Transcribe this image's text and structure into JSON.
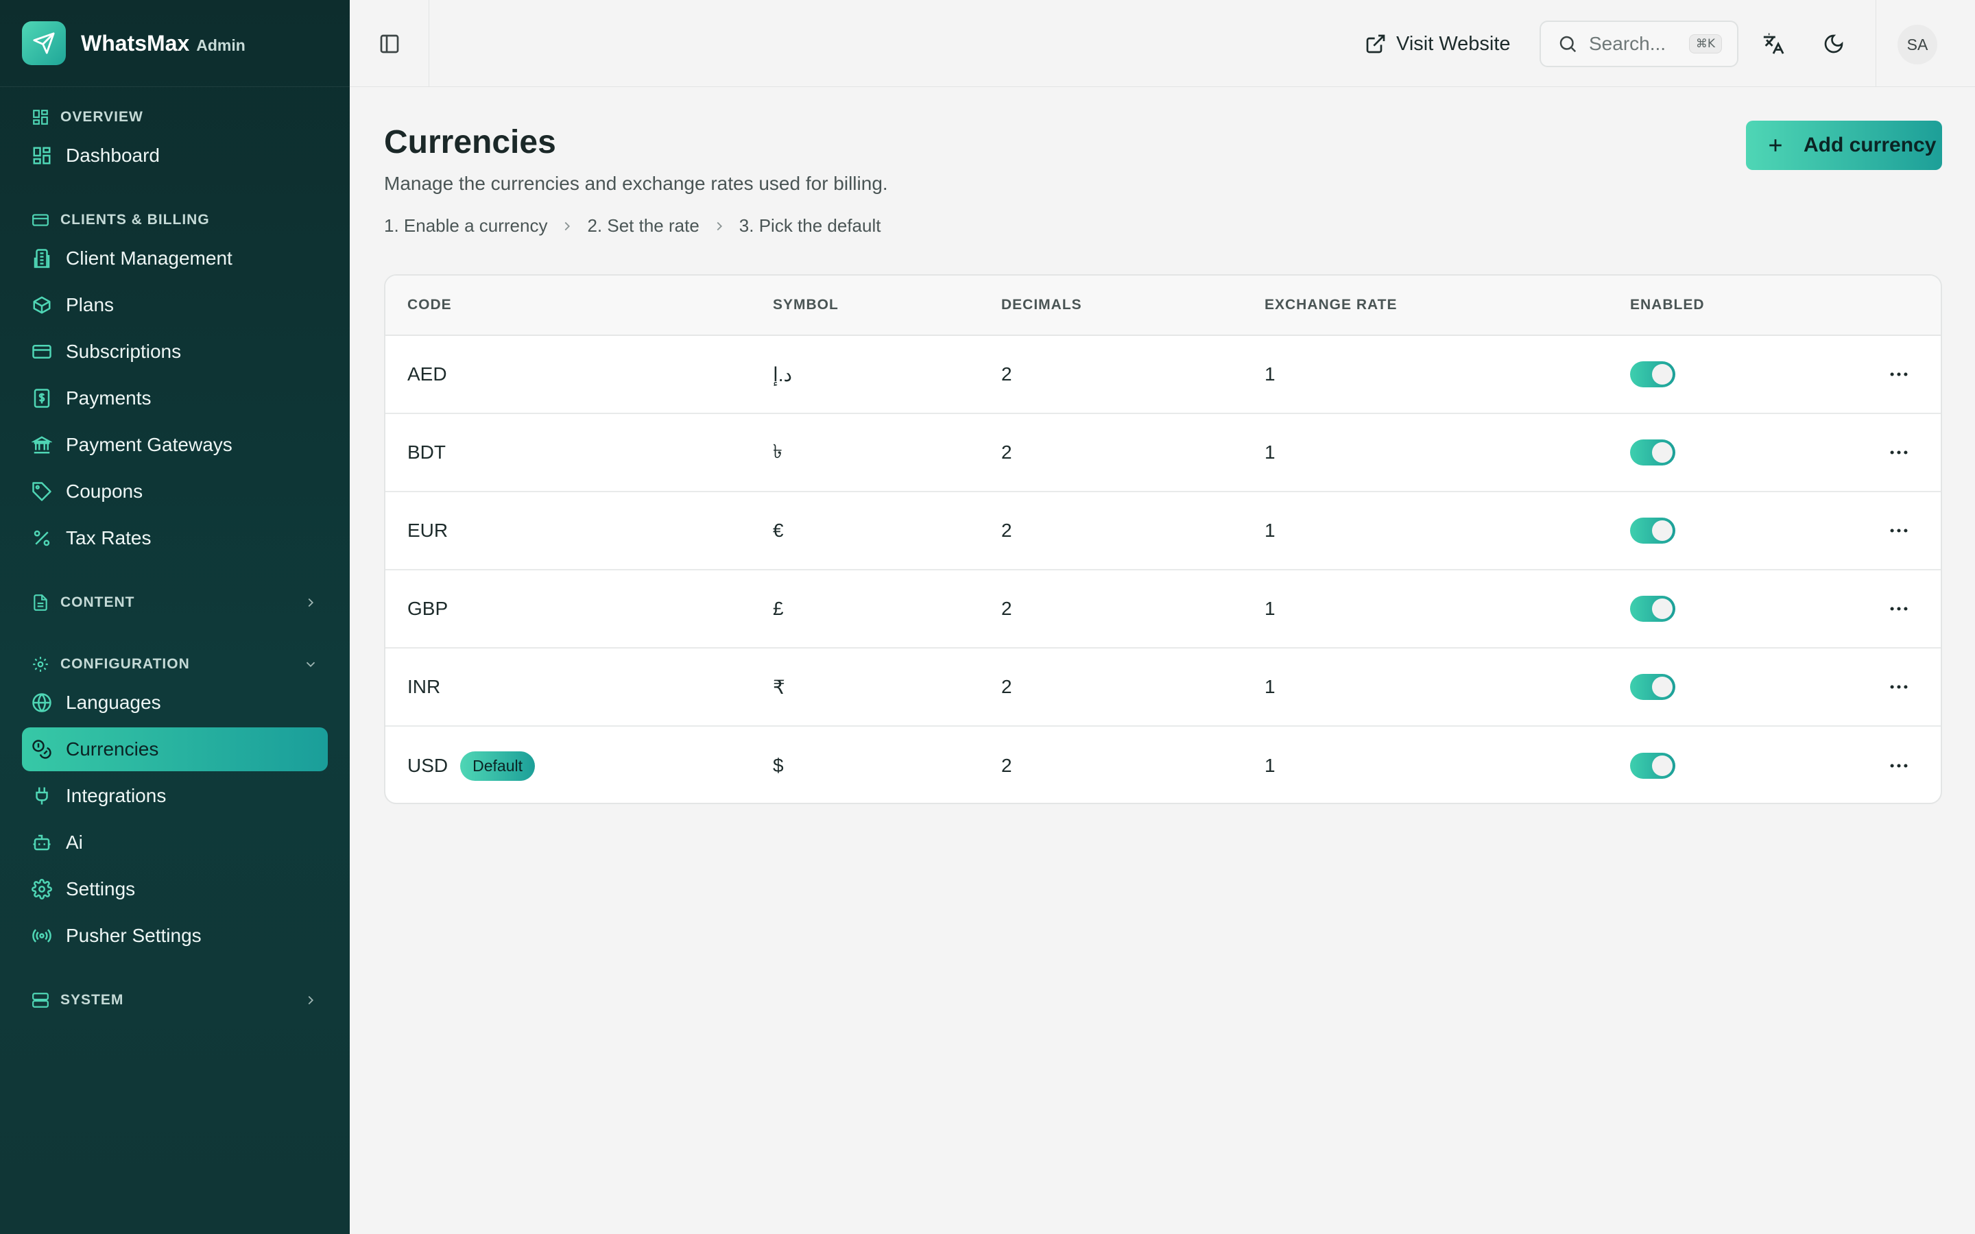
{
  "brand": {
    "name": "WhatsMax",
    "sub": "Admin"
  },
  "sidebar": {
    "overview": {
      "title": "OVERVIEW",
      "items": [
        {
          "label": "Dashboard",
          "icon": "dashboard-icon"
        }
      ]
    },
    "clients_billing": {
      "title": "CLIENTS & BILLING",
      "items": [
        {
          "label": "Client Management",
          "icon": "building-icon"
        },
        {
          "label": "Plans",
          "icon": "package-icon"
        },
        {
          "label": "Subscriptions",
          "icon": "credit-card-icon"
        },
        {
          "label": "Payments",
          "icon": "receipt-icon"
        },
        {
          "label": "Payment Gateways",
          "icon": "bank-icon"
        },
        {
          "label": "Coupons",
          "icon": "tag-icon"
        },
        {
          "label": "Tax Rates",
          "icon": "percent-icon"
        }
      ]
    },
    "content": {
      "title": "CONTENT"
    },
    "configuration": {
      "title": "CONFIGURATION",
      "items": [
        {
          "label": "Languages",
          "icon": "globe-icon"
        },
        {
          "label": "Currencies",
          "icon": "coins-icon",
          "active": true
        },
        {
          "label": "Integrations",
          "icon": "plug-icon"
        },
        {
          "label": "Ai",
          "icon": "robot-icon"
        },
        {
          "label": "Settings",
          "icon": "gear-icon"
        },
        {
          "label": "Pusher Settings",
          "icon": "radio-icon"
        }
      ]
    },
    "system": {
      "title": "SYSTEM"
    }
  },
  "topbar": {
    "visit_label": "Visit Website",
    "search_placeholder": "Search...",
    "search_shortcut": "⌘K",
    "avatar_initials": "SA"
  },
  "page": {
    "title": "Currencies",
    "description": "Manage the currencies and exchange rates used for billing.",
    "steps": [
      "1.  Enable a currency",
      "2.  Set the rate",
      "3.  Pick the default"
    ],
    "add_button": "Add currency"
  },
  "table": {
    "columns": [
      "CODE",
      "SYMBOL",
      "DECIMALS",
      "EXCHANGE RATE",
      "ENABLED"
    ],
    "rows": [
      {
        "code": "AED",
        "symbol": "د.إ",
        "decimals": "2",
        "rate": "1",
        "enabled": true,
        "default": ""
      },
      {
        "code": "BDT",
        "symbol": "৳",
        "decimals": "2",
        "rate": "1",
        "enabled": true,
        "default": ""
      },
      {
        "code": "EUR",
        "symbol": "€",
        "decimals": "2",
        "rate": "1",
        "enabled": true,
        "default": ""
      },
      {
        "code": "GBP",
        "symbol": "£",
        "decimals": "2",
        "rate": "1",
        "enabled": true,
        "default": ""
      },
      {
        "code": "INR",
        "symbol": "₹",
        "decimals": "2",
        "rate": "1",
        "enabled": true,
        "default": ""
      },
      {
        "code": "USD",
        "symbol": "$",
        "decimals": "2",
        "rate": "1",
        "enabled": true,
        "default": "Default"
      }
    ]
  },
  "colors": {
    "accent": "#37c8a6",
    "accent_dark": "#1a9e9a",
    "sidebar_bg": "#0f3434"
  }
}
